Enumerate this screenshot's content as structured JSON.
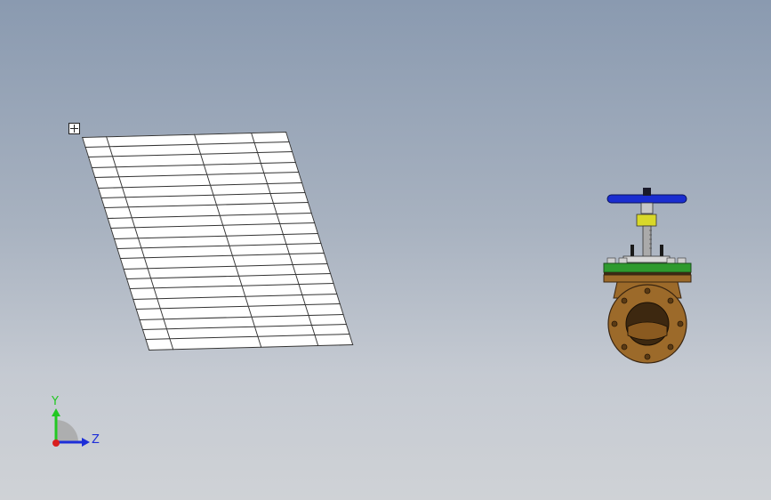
{
  "bom_table": {
    "headers": [
      "",
      "",
      "",
      ""
    ],
    "rows": [
      [
        "",
        "",
        "",
        ""
      ],
      [
        "",
        "",
        "",
        ""
      ],
      [
        "",
        "",
        "",
        ""
      ],
      [
        "",
        "",
        "",
        ""
      ],
      [
        "",
        "",
        "",
        ""
      ],
      [
        "",
        "",
        "",
        ""
      ],
      [
        "",
        "",
        "",
        ""
      ],
      [
        "",
        "",
        "",
        ""
      ],
      [
        "",
        "",
        "",
        ""
      ],
      [
        "",
        "",
        "",
        ""
      ],
      [
        "",
        "",
        "",
        ""
      ],
      [
        "",
        "",
        "",
        ""
      ],
      [
        "",
        "",
        "",
        ""
      ],
      [
        "",
        "",
        "",
        ""
      ],
      [
        "",
        "",
        "",
        ""
      ],
      [
        "",
        "",
        "",
        ""
      ],
      [
        "",
        "",
        "",
        ""
      ],
      [
        "",
        "",
        "",
        ""
      ],
      [
        "",
        "",
        "",
        ""
      ],
      [
        "",
        "",
        "",
        ""
      ]
    ]
  },
  "triad": {
    "y_label": "Y",
    "z_label": "Z",
    "y_color": "#22c822",
    "z_color": "#1d2ed8",
    "x_color": "#d81e1e"
  },
  "model": {
    "handwheel_color": "#1a2dd0",
    "bonnet_color": "#2e9a2e",
    "body_color": "#9c6a2a",
    "gland_color": "#d8d82a"
  }
}
